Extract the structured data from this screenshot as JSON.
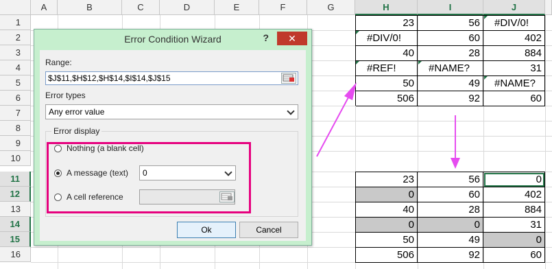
{
  "spreadsheet": {
    "columns": [
      "A",
      "B",
      "C",
      "D",
      "E",
      "F",
      "G",
      "H",
      "I",
      "J"
    ],
    "rows": [
      "1",
      "2",
      "3",
      "4",
      "5",
      "6",
      "7",
      "8",
      "9",
      "10",
      "11",
      "12",
      "13",
      "14",
      "15",
      "16"
    ],
    "before": [
      [
        "23",
        "56",
        "#DIV/0!"
      ],
      [
        "#DIV/0!",
        "60",
        "402"
      ],
      [
        "40",
        "28",
        "884"
      ],
      [
        "#REF!",
        "#NAME?",
        "31"
      ],
      [
        "50",
        "49",
        "#NAME?"
      ],
      [
        "506",
        "92",
        "60"
      ]
    ],
    "after": [
      [
        "23",
        "56",
        "0"
      ],
      [
        "0",
        "60",
        "402"
      ],
      [
        "40",
        "28",
        "884"
      ],
      [
        "0",
        "0",
        "31"
      ],
      [
        "50",
        "49",
        "0"
      ],
      [
        "506",
        "92",
        "60"
      ]
    ]
  },
  "dialog": {
    "title": "Error Condition Wizard",
    "help_label": "?",
    "close_label": "✕",
    "range_label": "Range:",
    "range_value": "$J$11,$H$12,$H$14,$I$14,$J$15",
    "error_types_label": "Error types",
    "error_types_value": "Any error value",
    "error_display_label": "Error display",
    "option_nothing": "Nothing (a blank cell)",
    "option_message": "A message (text)",
    "message_value": "0",
    "option_reference": "A cell reference",
    "ok_label": "Ok",
    "cancel_label": "Cancel"
  },
  "colors": {
    "accent": "#217346",
    "highlight": "#e6007e",
    "dialog_frame": "#c6efce"
  },
  "icons": [
    "range-select-icon",
    "dropdown-chevron-icon",
    "close-icon",
    "help-icon",
    "arrow-icon"
  ]
}
